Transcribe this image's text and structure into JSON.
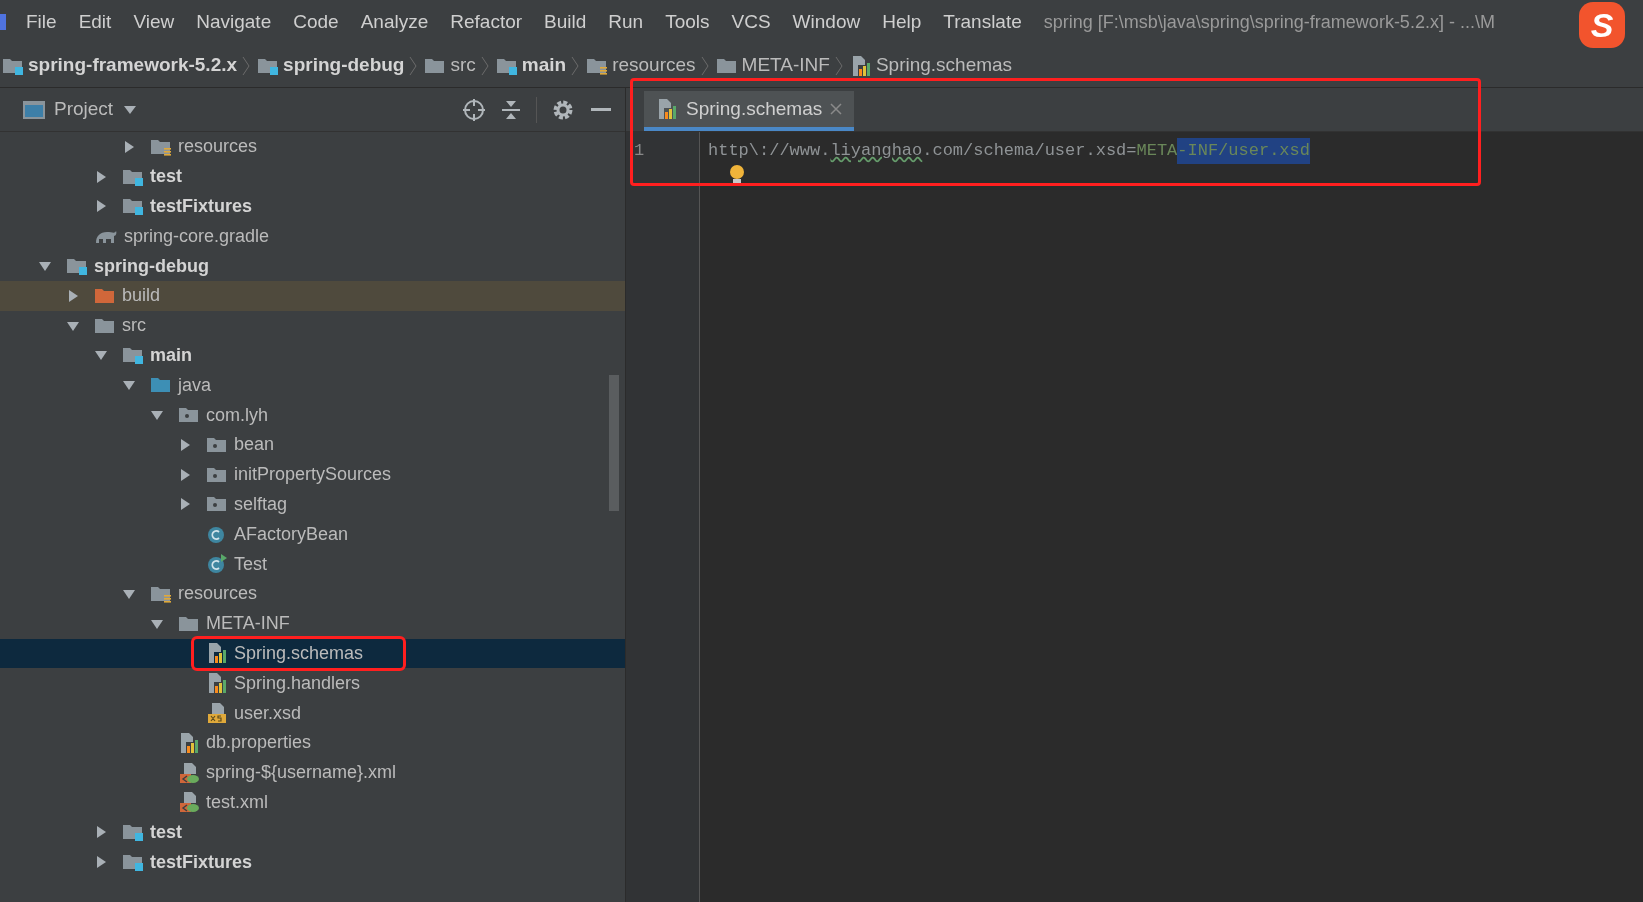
{
  "menu_bar": {
    "items": [
      "File",
      "Edit",
      "View",
      "Navigate",
      "Code",
      "Analyze",
      "Refactor",
      "Build",
      "Run",
      "Tools",
      "VCS",
      "Window",
      "Help",
      "Translate"
    ],
    "title": "spring [F:\\msb\\java\\spring\\spring-framework-5.2.x] - ...\\M",
    "ime_indicator": "S"
  },
  "breadcrumbs": [
    {
      "label": "spring-framework-5.2.x",
      "kind": "module"
    },
    {
      "label": "spring-debug",
      "kind": "module"
    },
    {
      "label": "src",
      "kind": "folder"
    },
    {
      "label": "main",
      "kind": "source-root"
    },
    {
      "label": "resources",
      "kind": "resource-folder"
    },
    {
      "label": "META-INF",
      "kind": "folder"
    },
    {
      "label": "Spring.schemas",
      "kind": "properties"
    }
  ],
  "project_panel": {
    "title": "Project",
    "tree": [
      {
        "children": [
          {
            "children": [
              {
                "children": [
                  {
                    "label": "resources",
                    "kind": "resource-folder",
                    "expanded": false,
                    "selected": false,
                    "annotated": false
                  }
                ]
              },
              {
                "label": "test",
                "kind": "source-root",
                "expanded": false,
                "selected": false,
                "annotated": false
              },
              {
                "label": "testFixtures",
                "kind": "source-root",
                "expanded": false,
                "selected": false,
                "annotated": false
              }
            ]
          },
          {
            "label": "spring-core.gradle",
            "kind": "gradle",
            "selected": false,
            "annotated": false
          }
        ]
      },
      {
        "label": "spring-debug",
        "kind": "module",
        "expanded": true,
        "selected": false,
        "annotated": false,
        "children": [
          {
            "label": "build",
            "kind": "excluded-folder",
            "expanded": false,
            "selected": false,
            "annotated": false
          },
          {
            "label": "src",
            "kind": "folder",
            "expanded": true,
            "selected": false,
            "annotated": false,
            "children": [
              {
                "label": "main",
                "kind": "source-root",
                "expanded": true,
                "selected": false,
                "annotated": false,
                "children": [
                  {
                    "label": "java",
                    "kind": "java-folder",
                    "expanded": true,
                    "selected": false,
                    "annotated": false,
                    "children": [
                      {
                        "label": "com.lyh",
                        "kind": "package",
                        "expanded": true,
                        "selected": false,
                        "annotated": false,
                        "children": [
                          {
                            "label": "bean",
                            "kind": "package",
                            "expanded": false,
                            "selected": false,
                            "annotated": false
                          },
                          {
                            "label": "initPropertySources",
                            "kind": "package",
                            "expanded": false,
                            "selected": false,
                            "annotated": false
                          },
                          {
                            "label": "selftag",
                            "kind": "package",
                            "expanded": false,
                            "selected": false,
                            "annotated": false
                          },
                          {
                            "label": "AFactoryBean",
                            "kind": "class",
                            "selected": false,
                            "annotated": false
                          },
                          {
                            "label": "Test",
                            "kind": "runnable-class",
                            "selected": false,
                            "annotated": false
                          }
                        ]
                      }
                    ]
                  },
                  {
                    "label": "resources",
                    "kind": "resource-folder",
                    "expanded": true,
                    "selected": false,
                    "annotated": false,
                    "children": [
                      {
                        "label": "META-INF",
                        "kind": "folder",
                        "expanded": true,
                        "selected": false,
                        "annotated": false,
                        "children": [
                          {
                            "label": "Spring.schemas",
                            "kind": "properties",
                            "selected": true,
                            "annotated": true
                          },
                          {
                            "label": "Spring.handlers",
                            "kind": "properties",
                            "selected": false,
                            "annotated": false
                          },
                          {
                            "label": "user.xsd",
                            "kind": "xsd",
                            "selected": false,
                            "annotated": false
                          }
                        ]
                      },
                      {
                        "label": "db.properties",
                        "kind": "properties",
                        "selected": false,
                        "annotated": false
                      },
                      {
                        "label": "spring-${username}.xml",
                        "kind": "spring-xml",
                        "selected": false,
                        "annotated": false
                      },
                      {
                        "label": "test.xml",
                        "kind": "spring-xml",
                        "selected": false,
                        "annotated": false
                      }
                    ]
                  }
                ]
              },
              {
                "label": "test",
                "kind": "source-root",
                "expanded": false,
                "selected": false,
                "annotated": false
              },
              {
                "label": "testFixtures",
                "kind": "source-root",
                "expanded": false,
                "selected": false,
                "annotated": false
              }
            ]
          }
        ]
      }
    ]
  },
  "editor": {
    "annotated": true,
    "tabs": [
      {
        "label": "Spring.schemas",
        "kind": "properties",
        "selected": true
      }
    ],
    "lines": [
      {
        "number": "1",
        "segments": [
          {
            "text": "http\\://www.",
            "kind": "key",
            "typo": false,
            "selected": false
          },
          {
            "text": "liyanghao",
            "kind": "key",
            "typo": true,
            "selected": false
          },
          {
            "text": ".com/schema/user.xsd=",
            "kind": "key",
            "typo": false,
            "selected": false
          },
          {
            "text": "META",
            "kind": "value",
            "typo": false,
            "selected": false
          },
          {
            "text": "-INF/user.xsd",
            "kind": "value",
            "typo": false,
            "selected": true
          }
        ]
      }
    ],
    "intention_bulb": true
  }
}
